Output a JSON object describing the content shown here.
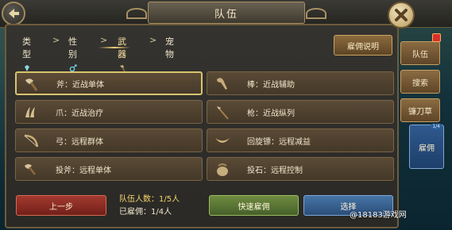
{
  "header": {
    "title": "队伍"
  },
  "breadcrumbs": [
    {
      "label": "类型",
      "icon": "gem-icon"
    },
    {
      "label": "性别",
      "icon": "male-icon"
    },
    {
      "label": "武器",
      "icon": "axe-icon",
      "active": true
    },
    {
      "label": "宠物"
    }
  ],
  "breadcrumb_separator": ">",
  "hire_info_button": "雇佣说明",
  "options": [
    {
      "label": "斧：近战单体",
      "icon": "axe-icon",
      "selected": true
    },
    {
      "label": "棒：近战辅助",
      "icon": "club-icon"
    },
    {
      "label": "爪：近战治疗",
      "icon": "claw-icon"
    },
    {
      "label": "枪：近战纵列",
      "icon": "spear-icon"
    },
    {
      "label": "弓：远程群体",
      "icon": "bow-icon"
    },
    {
      "label": "回旋镖：远程减益",
      "icon": "boomerang-icon"
    },
    {
      "label": "投斧：远程单体",
      "icon": "throwing-axe-icon"
    },
    {
      "label": "投石：远程控制",
      "icon": "stone-icon"
    }
  ],
  "footer": {
    "prev_label": "上一步",
    "party_count_label": "队伍人数：1/5人",
    "hired_label": "已雇佣：1/4人",
    "quick_hire_label": "快速雇佣",
    "select_label": "选择"
  },
  "side_tabs": [
    {
      "label": "队伍"
    },
    {
      "label": "搜索"
    },
    {
      "label": "镰刀草"
    },
    {
      "label": "雇佣",
      "badge": "1/4",
      "active": true
    }
  ],
  "watermark": "@18183游戏网",
  "colors": {
    "selected_border": "#d8c46e",
    "prev": "#a43a2f",
    "quick": "#6e8b3f",
    "select": "#4674a6",
    "active_tab": "#30598e"
  }
}
